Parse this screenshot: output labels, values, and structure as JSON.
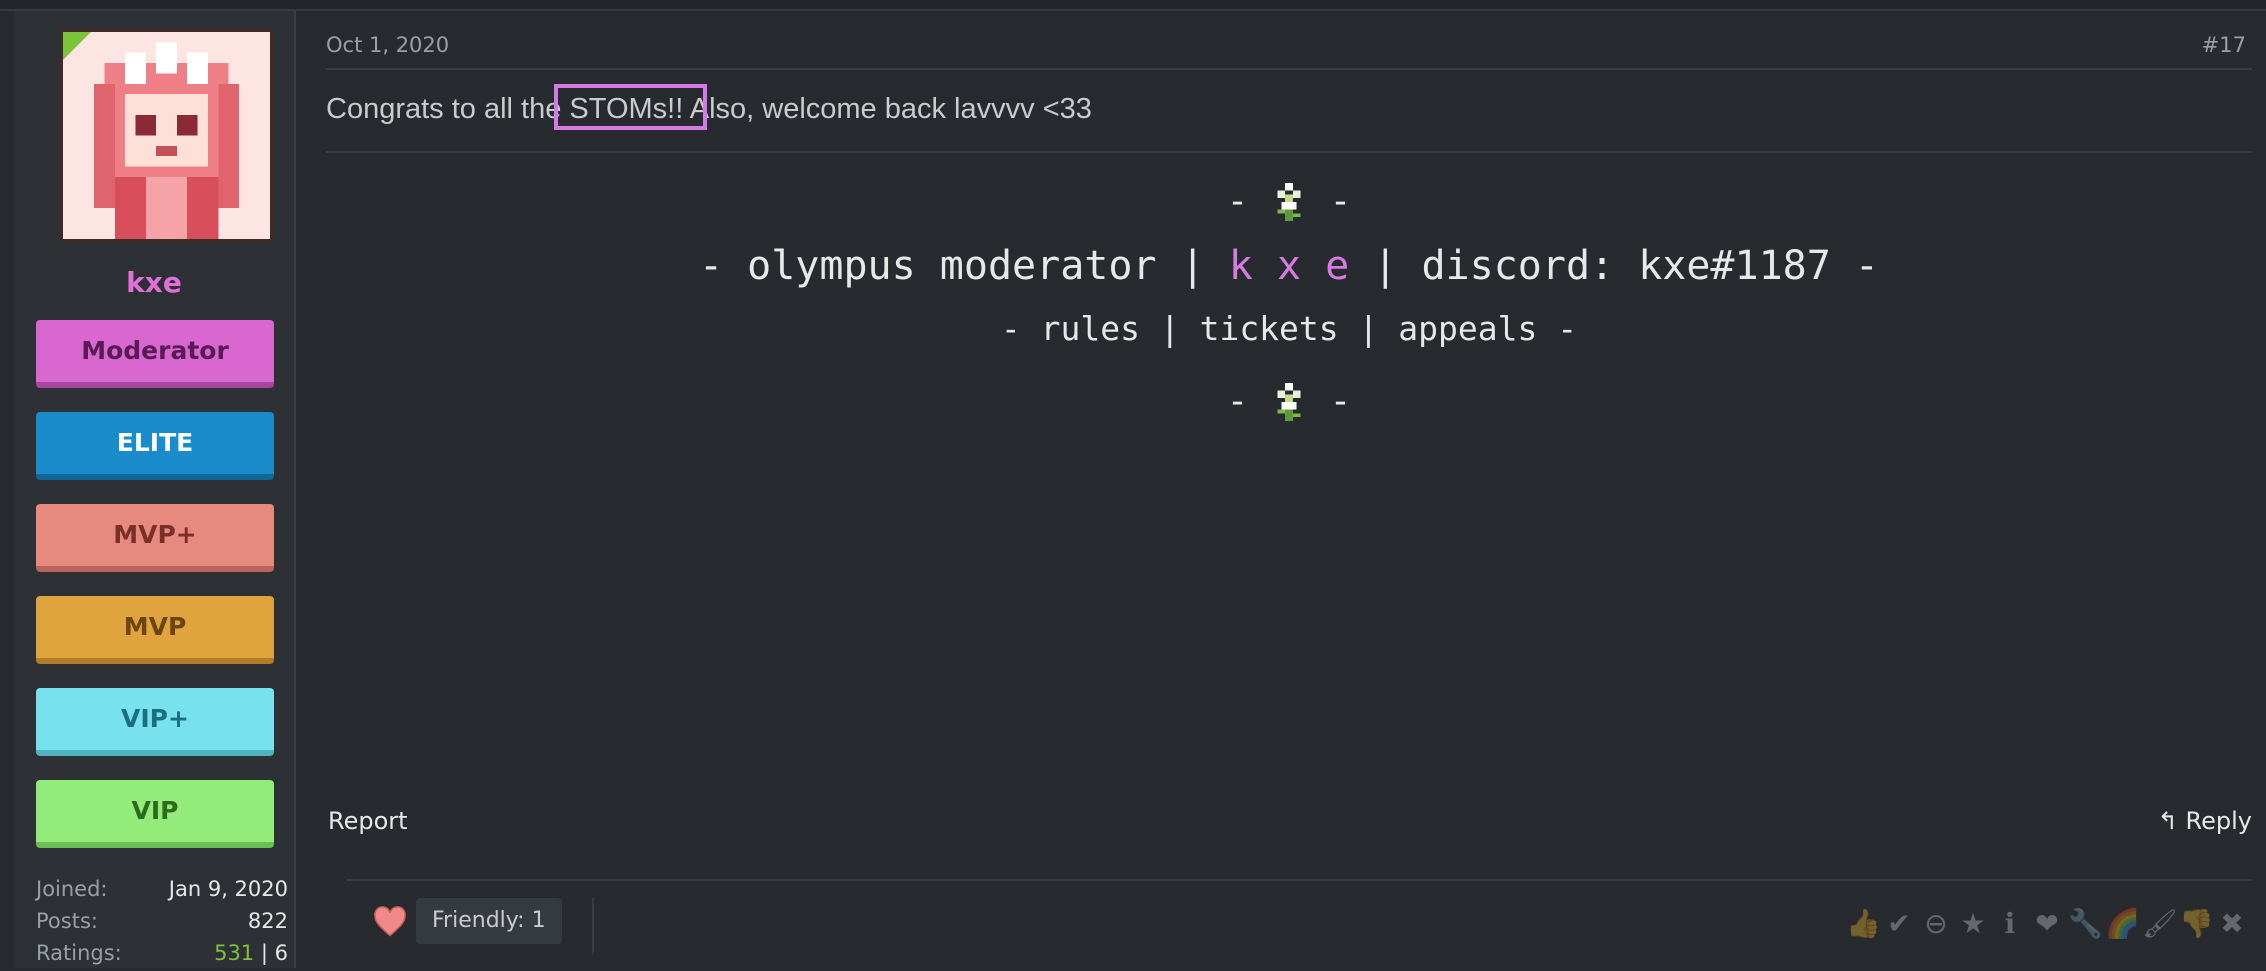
{
  "user": {
    "username": "kxe",
    "badges": [
      "Moderator",
      "ELITE",
      "MVP+",
      "MVP",
      "VIP+",
      "VIP"
    ],
    "stats": {
      "joined_label": "Joined:",
      "joined_value": "Jan 9, 2020",
      "posts_label": "Posts:",
      "posts_value": "822",
      "ratings_label": "Ratings:",
      "ratings_positive": "531",
      "ratings_sep": "|",
      "ratings_negative": "6"
    }
  },
  "post": {
    "date": "Oct 1, 2020",
    "number": "#17",
    "message": "Congrats to all the STOMs!! Also, welcome back lavvvv <33",
    "signature": {
      "flower_dash": "- ✿ -",
      "line1_a": "- olympus moderator | ",
      "line1_name": "k x e",
      "line1_b": " | discord: kxe#1187 -",
      "line2": "- rules | tickets | appeals -"
    },
    "report_label": "Report",
    "reply_label": "Reply",
    "reaction_pill": "Friendly: 1"
  },
  "colors": {
    "background": "#272b30",
    "username": "#e36fdb",
    "highlight": "#d67be6"
  },
  "icons": [
    "thumbs-up-icon",
    "check-icon",
    "minus-icon",
    "star-icon",
    "info-icon",
    "heart-icon",
    "wrench-icon",
    "rainbow-icon",
    "brush-icon",
    "thumbs-down-icon",
    "x-icon"
  ]
}
